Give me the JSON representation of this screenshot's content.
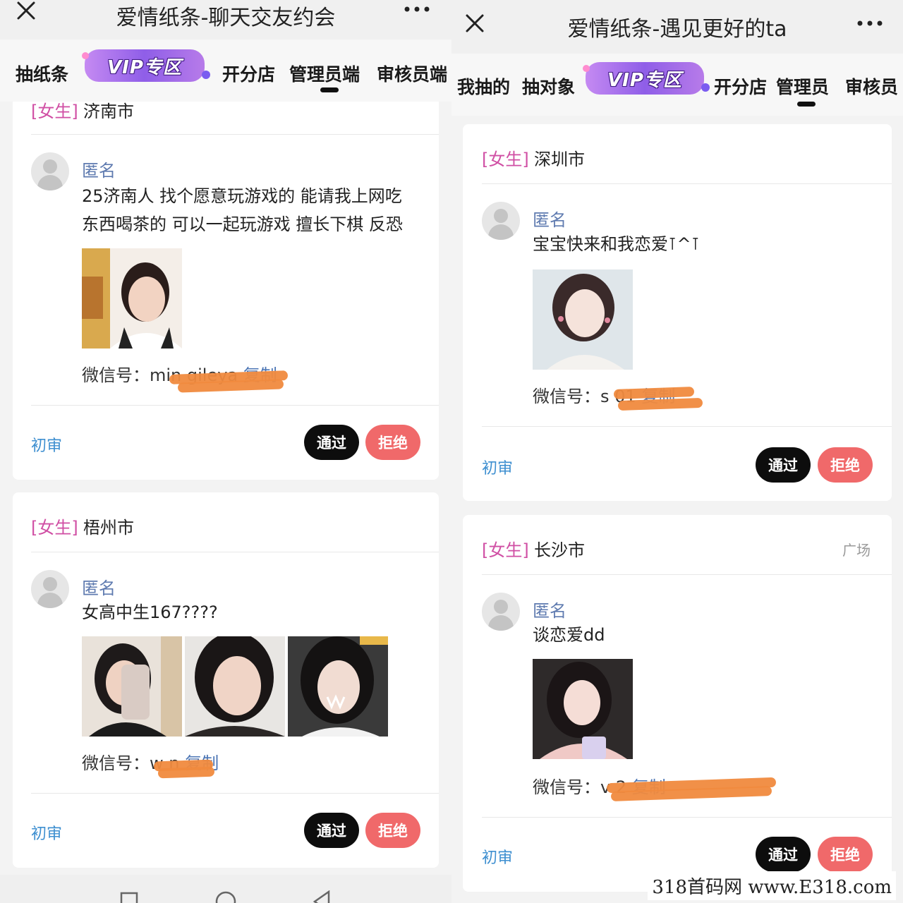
{
  "left": {
    "title": "爱情纸条-聊天交友约会",
    "tabs": [
      "抽纸条",
      "开分店",
      "管理员端",
      "审核员端"
    ],
    "vip_label": "VIP专区",
    "cards": [
      {
        "gender": "[女生]",
        "city": "济南市",
        "author": "匿名",
        "text_line1": "25济南人 找个愿意玩游戏的 能请我上网吃",
        "text_line2": "东西喝茶的 可以一起玩游戏 擅长下棋 反恐",
        "wechat_label": "微信号：",
        "wechat_value": "min                 gileya",
        "copy": "复制",
        "status": "初审",
        "pass": "通过",
        "reject": "拒绝"
      },
      {
        "gender": "[女生]",
        "city": "梧州市",
        "author": "匿名",
        "text_line1": "女高中生167????",
        "wechat_label": "微信号：",
        "wechat_value": "w       n",
        "copy": "复制",
        "status": "初审",
        "pass": "通过",
        "reject": "拒绝"
      }
    ]
  },
  "right": {
    "title": "爱情纸条-遇见更好的ta",
    "tabs": [
      "我抽的",
      "抽对象",
      "开分店",
      "管理员",
      "审核员"
    ],
    "vip_label": "VIP专区",
    "cards": [
      {
        "gender": "[女生]",
        "city": "深圳市",
        "author": "匿名",
        "text_line1": "宝宝快来和我恋爱⊺^⊺",
        "wechat_label": "微信号：",
        "wechat_value": "s             01",
        "copy": "复制",
        "status": "初审",
        "pass": "通过",
        "reject": "拒绝"
      },
      {
        "gender": "[女生]",
        "city": "长沙市",
        "side_tag": "广场",
        "author": "匿名",
        "text_line1": "谈恋爱dd",
        "wechat_label": "微信号：",
        "wechat_value": "v                              2",
        "copy": "复制",
        "status": "初审",
        "pass": "通过",
        "reject": "拒绝"
      }
    ]
  },
  "watermark": "318首码网  www.E318.com",
  "colors": {
    "gender": "#d04fa4",
    "author": "#5f7bb0",
    "link": "#4a74b4",
    "status": "#3e8fd0",
    "pass_btn": "#0d0d0d",
    "reject_btn": "#f0696a",
    "redaction": "#f08a3e"
  },
  "icons": [
    "close-icon",
    "more-icon",
    "avatar-placeholder-icon"
  ]
}
